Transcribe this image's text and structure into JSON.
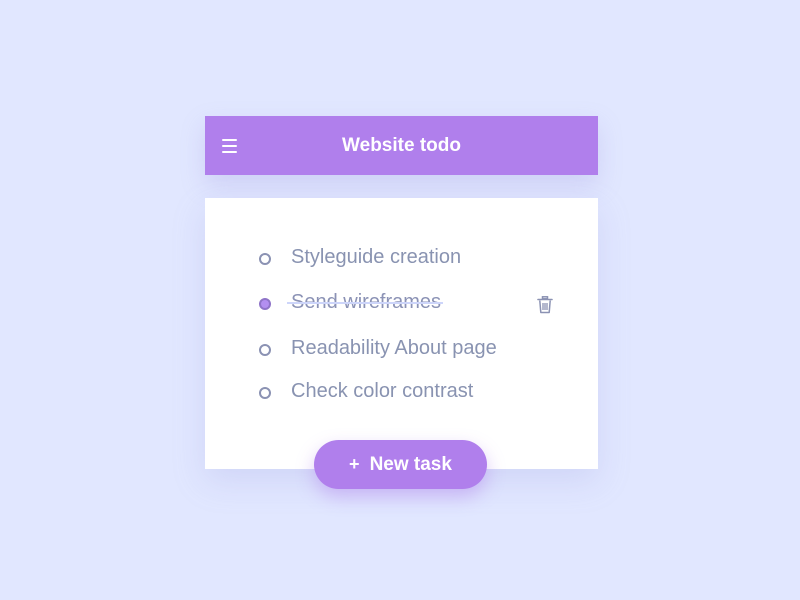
{
  "app": {
    "title": "Website todo"
  },
  "tasks": [
    {
      "label": "Styleguide creation",
      "done": false
    },
    {
      "label": "Send wireframes",
      "done": true
    },
    {
      "label": "Readability About page",
      "done": false
    },
    {
      "label": "Check color contrast",
      "done": false
    }
  ],
  "actions": {
    "new_task_plus": "+",
    "new_task_label": "New task"
  },
  "icons": {
    "menu": "hamburger-menu-icon",
    "delete": "trash-icon"
  },
  "colors": {
    "background": "#e1e7ff",
    "accent": "#b07fec",
    "text": "#8993b1"
  }
}
